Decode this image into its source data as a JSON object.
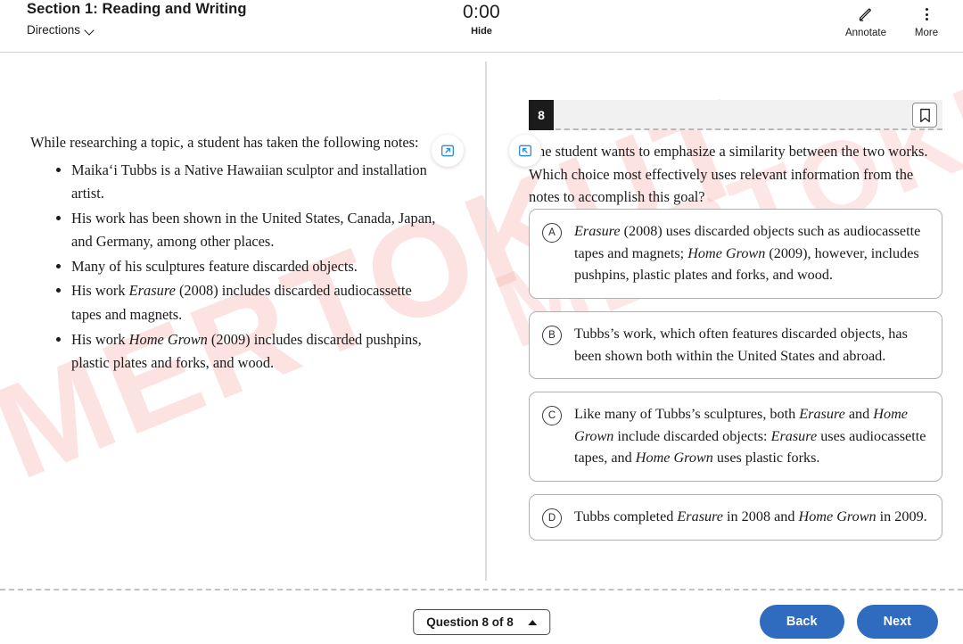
{
  "header": {
    "section_title": "Section 1: Reading and Writing",
    "directions_label": "Directions",
    "directions_icon": "chevron-down-icon",
    "timer": "0:00",
    "hide_label": "Hide",
    "annotate_label": "Annotate",
    "annotate_icon": "pencil-icon",
    "more_label": "More",
    "more_icon": "vertical-dots-icon"
  },
  "panes": {
    "expand_left_icon": "expand-panel-right-icon",
    "expand_right_icon": "expand-panel-left-icon"
  },
  "passage": {
    "intro": "While researching a topic, a student has taken the following notes:",
    "notes": [
      "Maika‘i Tubbs is a Native Hawaiian sculptor and installation artist.",
      "His work has been shown in the United States, Canada, Japan, and Germany, among other places.",
      "Many of his sculptures feature discarded objects.",
      "His work Erasure (2008) includes discarded audiocassette tapes and magnets.",
      "His work Home Grown (2009) includes discarded pushpins, plastic plates and forks, and wood."
    ]
  },
  "question": {
    "number": "8",
    "bookmark_icon": "bookmark-icon",
    "stem": "The student wants to emphasize a similarity between the two works. Which choice most effectively uses relevant information from the notes to accomplish this goal?",
    "choices": [
      {
        "letter": "A",
        "text": "Erasure (2008) uses discarded objects such as audiocassette tapes and magnets; Home Grown (2009), however, includes pushpins, plastic plates and forks, and wood."
      },
      {
        "letter": "B",
        "text": "Tubbs’s work, which often features discarded objects, has been shown both within the United States and abroad."
      },
      {
        "letter": "C",
        "text": "Like many of Tubbs’s sculptures, both Erasure and Home Grown include discarded objects: Erasure uses audiocassette tapes, and Home Grown uses plastic forks."
      },
      {
        "letter": "D",
        "text": "Tubbs completed Erasure in 2008 and Home Grown in 2009."
      }
    ]
  },
  "footer": {
    "question_picker": "Question 8 of 8",
    "picker_icon": "caret-up-icon",
    "back_label": "Back",
    "next_label": "Next"
  },
  "watermark": {
    "text": "MERTOKUT"
  },
  "colors": {
    "accent_blue": "#2f6bbf",
    "icon_blue": "#3a8fd4",
    "badge_black": "#1b1b1b",
    "watermark_pink": "#f6a6a0"
  }
}
